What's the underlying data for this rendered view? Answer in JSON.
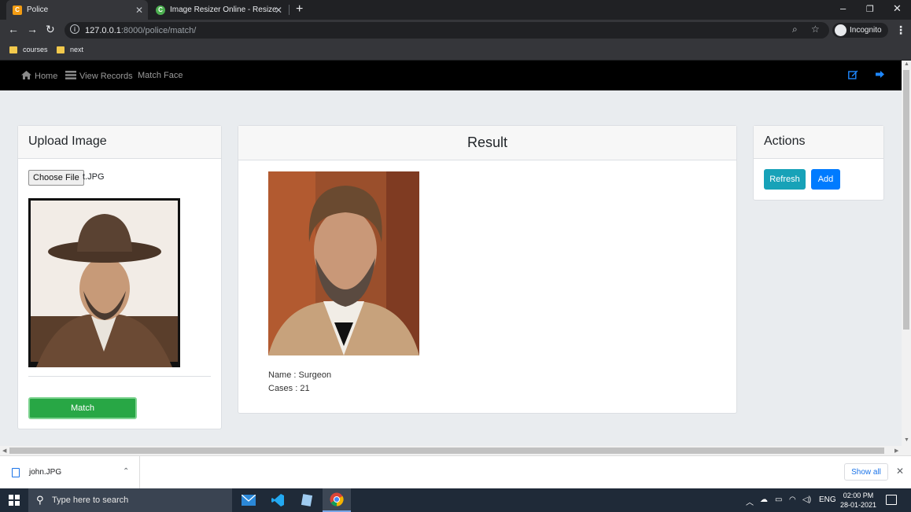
{
  "browser": {
    "tabs": [
      {
        "title": "Police",
        "favicon_letter": "C",
        "favicon_color": "#f39c12",
        "active": true
      },
      {
        "title": "Image Resizer Online - Resize JPG",
        "favicon_letter": "C",
        "favicon_color": "#4caf50",
        "active": false
      }
    ],
    "url_host": "127.0.0.1",
    "url_path": ":8000/police/match/",
    "profile_label": "Incognito",
    "bookmarks": [
      "courses",
      "next"
    ]
  },
  "navbar": {
    "links": [
      "Home",
      "View Records",
      "Match Face"
    ]
  },
  "upload_card": {
    "title": "Upload Image",
    "choose_file_label": "Choose File",
    "file_name": "t.JPG",
    "match_label": "Match"
  },
  "result_card": {
    "title": "Result",
    "name_line": "Name : Surgeon",
    "cases_line": "Cases : 21"
  },
  "actions_card": {
    "title": "Actions",
    "refresh_label": "Refresh",
    "add_label": "Add",
    "refresh_color": "#17a2b8",
    "add_color": "#007bff"
  },
  "download_bar": {
    "file_name": "john.JPG",
    "show_all_label": "Show all"
  },
  "taskbar": {
    "search_placeholder": "Type here to search",
    "language": "ENG",
    "time": "02:00 PM",
    "date": "28-01-2021"
  },
  "colors": {
    "match_green": "#28a745",
    "navbar_black": "#000000",
    "page_bg": "#e9ecef"
  }
}
